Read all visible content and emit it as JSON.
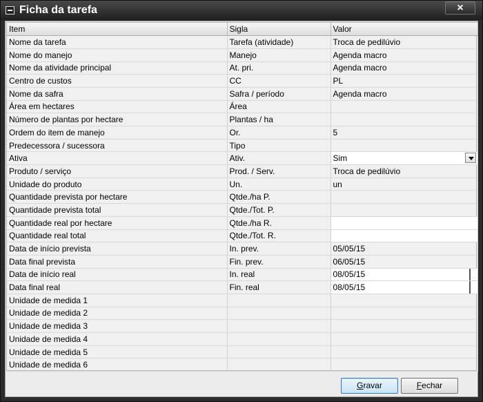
{
  "window": {
    "title": "Ficha da tarefa",
    "close_symbol": "×"
  },
  "table": {
    "headers": [
      "Item",
      "Sigla",
      "Valor"
    ],
    "rows": [
      {
        "item": "Nome da tarefa",
        "sigla": "Tarefa (atividade)",
        "valor": "Troca de pedilúvio"
      },
      {
        "item": "Nome do manejo",
        "sigla": "Manejo",
        "valor": "Agenda macro"
      },
      {
        "item": "Nome da atividade principal",
        "sigla": "At. pri.",
        "valor": "Agenda macro"
      },
      {
        "item": "Centro de custos",
        "sigla": "CC",
        "valor": "PL"
      },
      {
        "item": "Nome da safra",
        "sigla": "Safra / período",
        "valor": "Agenda macro"
      },
      {
        "item": "Área em hectares",
        "sigla": "Área",
        "valor": ""
      },
      {
        "item": "Número de plantas por hectare",
        "sigla": "Plantas / ha",
        "valor": ""
      },
      {
        "item": "Ordem do item de manejo",
        "sigla": "Or.",
        "valor": "5"
      },
      {
        "item": "Predecessora / sucessora",
        "sigla": "Tipo",
        "valor": ""
      },
      {
        "item": "Ativa",
        "sigla": "Ativ.",
        "valor": "Sim"
      },
      {
        "item": "Produto / serviço",
        "sigla": "Prod. / Serv.",
        "valor": "Troca de pedilúvio"
      },
      {
        "item": "Unidade do produto",
        "sigla": "Un.",
        "valor": "un"
      },
      {
        "item": "Quantidade prevista por hectare",
        "sigla": "Qtde./ha P.",
        "valor": ""
      },
      {
        "item": "Quantidade prevista total",
        "sigla": "Qtde./Tot. P.",
        "valor": ""
      },
      {
        "item": "Quantidade real por hectare",
        "sigla": "Qtde./ha R.",
        "valor": ""
      },
      {
        "item": "Quantidade real total",
        "sigla": "Qtde./Tot. R.",
        "valor": ""
      },
      {
        "item": "Data de início prevista",
        "sigla": "In. prev.",
        "valor": "05/05/15"
      },
      {
        "item": "Data final prevista",
        "sigla": "Fin. prev.",
        "valor": "06/05/15"
      },
      {
        "item": "Data de início real",
        "sigla": "In. real",
        "valor": "08/05/15"
      },
      {
        "item": "Data final real",
        "sigla": "Fin. real",
        "valor": "08/05/15"
      },
      {
        "item": "Unidade de medida 1",
        "sigla": "",
        "valor": ""
      },
      {
        "item": "Unidade de medida 2",
        "sigla": "",
        "valor": ""
      },
      {
        "item": "Unidade de medida 3",
        "sigla": "",
        "valor": ""
      },
      {
        "item": "Unidade de medida 4",
        "sigla": "",
        "valor": ""
      },
      {
        "item": "Unidade de medida 5",
        "sigla": "",
        "valor": ""
      },
      {
        "item": "Unidade de medida 6",
        "sigla": "",
        "valor": ""
      }
    ]
  },
  "buttons": {
    "save_first": "G",
    "save_rest": "ravar",
    "close_first": "F",
    "close_rest": "echar"
  },
  "icons": {
    "window_icon": "minus-box-icon",
    "dropdown": "chevron-down-icon"
  }
}
